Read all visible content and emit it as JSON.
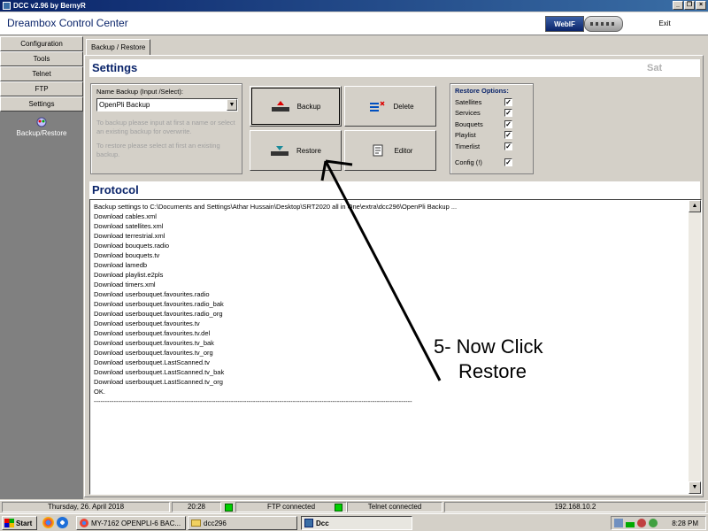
{
  "window": {
    "title": "DCC v2.96 by BernyR",
    "controls": [
      "_",
      "❐",
      "×"
    ]
  },
  "header": {
    "app_title": "Dreambox Control Center",
    "webif_label": "WebIF",
    "exit_label": "Exit"
  },
  "sidebar": {
    "items": [
      {
        "label": "Configuration"
      },
      {
        "label": "Tools"
      },
      {
        "label": "Telnet"
      },
      {
        "label": "FTP"
      },
      {
        "label": "Settings"
      }
    ],
    "sub_item": "Backup/Restore"
  },
  "tab": {
    "label": "Backup / Restore"
  },
  "settings": {
    "title": "Settings",
    "right_label": "Sat",
    "name_label": "Name Backup (Input /Select):",
    "name_value": "OpenPli Backup",
    "hint_backup": "To backup please input at first a name or select an existing backup for overwrite.",
    "hint_restore": "To restore please select at first an existing backup.",
    "buttons": {
      "backup": "Backup",
      "delete": "Delete",
      "restore": "Restore",
      "editor": "Editor"
    },
    "restore_options": {
      "title": "Restore Options:",
      "items": [
        {
          "label": "Satellites",
          "checked": true
        },
        {
          "label": "Services",
          "checked": true
        },
        {
          "label": "Bouquets",
          "checked": true
        },
        {
          "label": "Playlist",
          "checked": true
        },
        {
          "label": "Timerlist",
          "checked": true
        }
      ],
      "config": {
        "label": "Config (!)",
        "checked": true
      }
    }
  },
  "protocol": {
    "title": "Protocol",
    "lines": [
      "Backup settings to C:\\Documents and Settings\\Athar Hussain\\Desktop\\SRT2020 all in One\\extra\\dcc296\\OpenPli Backup ...",
      "Download cables.xml",
      "Download satellites.xml",
      "Download terrestrial.xml",
      "Download bouquets.radio",
      "Download bouquets.tv",
      "Download lamedb",
      "Download playlist.e2pls",
      "Download timers.xml",
      "Download userbouquet.favourites.radio",
      "Download userbouquet.favourites.radio_bak",
      "Download userbouquet.favourites.radio_org",
      "Download userbouquet.favourites.tv",
      "Download userbouquet.favourites.tv.del",
      "Download userbouquet.favourites.tv_bak",
      "Download userbouquet.favourites.tv_org",
      "Download userbouquet.LastScanned.tv",
      "Download userbouquet.LastScanned.tv_bak",
      "Download userbouquet.LastScanned.tv_org",
      "OK.",
      "------------------------------------------------------------------------------------------------------------------------------------------------"
    ]
  },
  "annotation": {
    "line1": "5- Now Click",
    "line2": "Restore"
  },
  "statusbar": {
    "date": "Thursday, 26. April 2018",
    "time": "20:28",
    "ftp": "FTP connected",
    "telnet": "Telnet connected",
    "ip": "192.168.10.2",
    "led_color": "#00d000"
  },
  "taskbar": {
    "start": "Start",
    "tasks": [
      {
        "label": "MY-7162 OPENPLI-6 BAC...",
        "icon": "chrome-icon"
      },
      {
        "label": "dcc296",
        "icon": "folder-icon"
      },
      {
        "label": "Dcc",
        "icon": "dcc-app-icon",
        "active": true
      }
    ],
    "clock": "8:28 PM"
  }
}
